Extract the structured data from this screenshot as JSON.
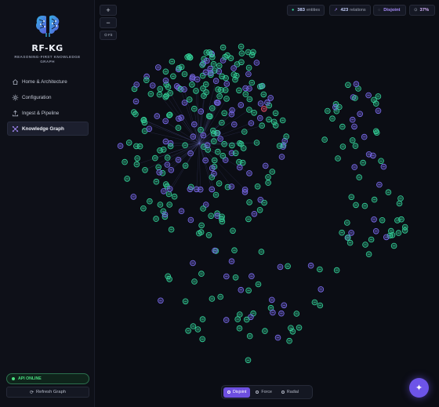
{
  "app": {
    "name": "RF-KG",
    "tagline": "REASONING-FIRST KNOWLEDGE GRAPH"
  },
  "sidebar": {
    "items": [
      {
        "label": "Home & Architecture",
        "icon": "home-icon",
        "active": false
      },
      {
        "label": "Configuration",
        "icon": "gear-icon",
        "active": false
      },
      {
        "label": "Ingest & Pipeline",
        "icon": "upload-icon",
        "active": false
      },
      {
        "label": "Knowledge Graph",
        "icon": "graph-icon",
        "active": true
      }
    ],
    "api_status": "API ONLINE",
    "refresh_label": "Refresh Graph"
  },
  "toolbar": {
    "zoom_in": "+",
    "zoom_out": "−",
    "fit": "Fit"
  },
  "stats": {
    "entities_count": "383",
    "entities_label": "entities",
    "relations_count": "423",
    "relations_label": "relations",
    "mode": "Disjoint",
    "percent": "37%"
  },
  "layout_options": [
    {
      "label": "Disjoint",
      "active": true
    },
    {
      "label": "Force",
      "active": false
    },
    {
      "label": "Radial",
      "active": false
    }
  ],
  "colors": {
    "accent": "#6d4fe0",
    "node_green": "#34d399",
    "node_purple": "#7c6cf0",
    "node_red": "#f0506e",
    "api_green": "#4ade80"
  }
}
